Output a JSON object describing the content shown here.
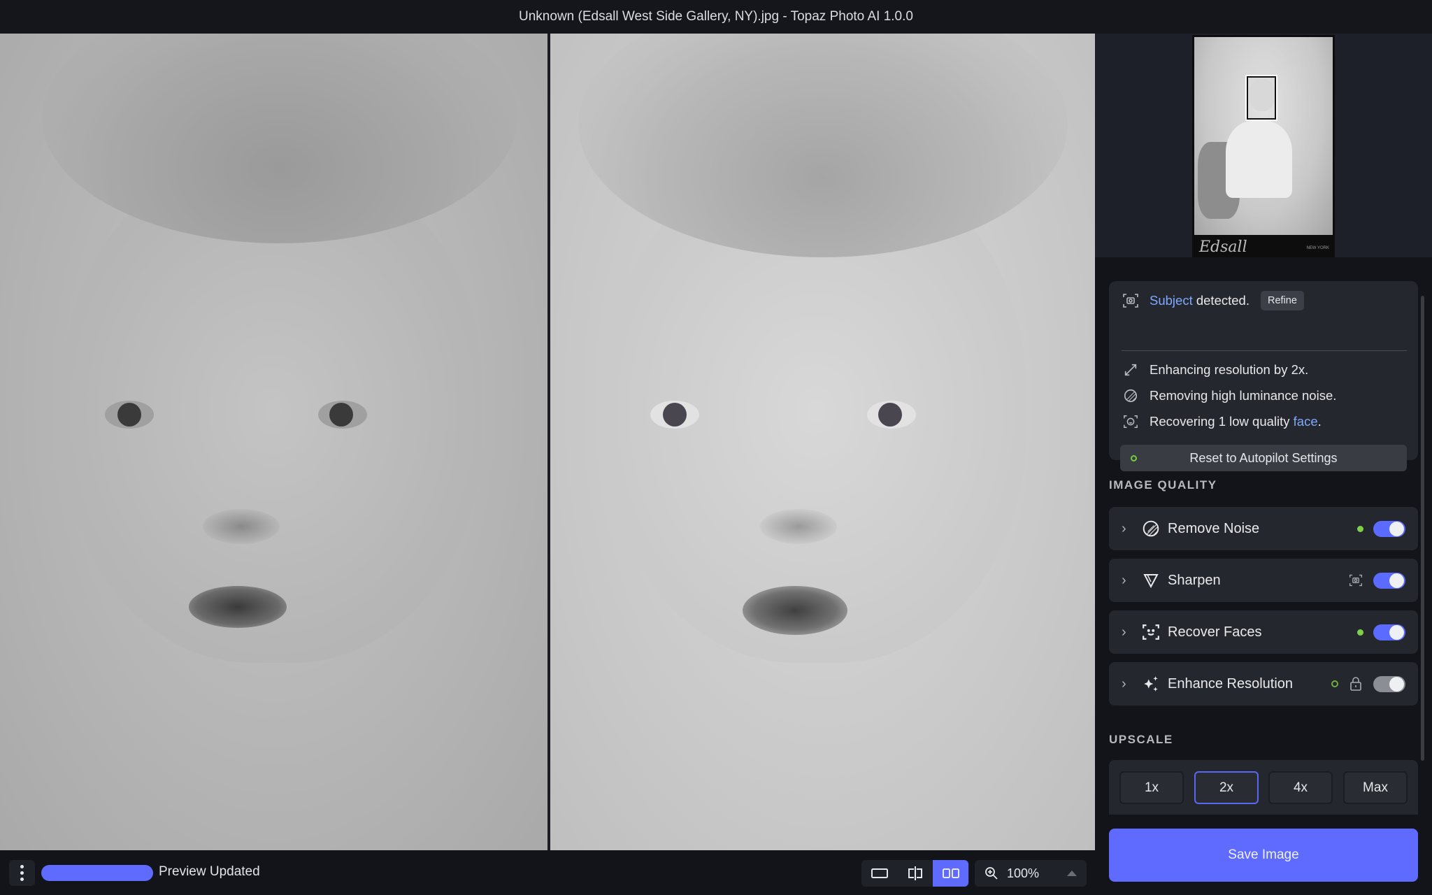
{
  "window": {
    "title": "Unknown (Edsall West Side Gallery, NY).jpg - Topaz Photo AI 1.0.0"
  },
  "viewer": {
    "left_pane": "original-image",
    "right_pane": "enhanced-preview"
  },
  "navigator": {
    "thumbnail_caption": "Edsall",
    "thumbnail_city": "NEW YORK"
  },
  "autopilot": {
    "subject_link": "Subject",
    "subject_text": " detected.",
    "refine_label": "Refine",
    "items": [
      {
        "icon": "resize-arrows-icon",
        "text": "Enhancing resolution by 2x."
      },
      {
        "icon": "noise-icon",
        "text": "Removing high luminance noise."
      },
      {
        "icon": "face-scan-icon",
        "text_before": "Recovering 1 low quality ",
        "link": "face",
        "text_after": "."
      }
    ],
    "reset_label": "Reset to Autopilot Settings"
  },
  "image_quality": {
    "title": "IMAGE QUALITY",
    "features": [
      {
        "label": "Remove Noise",
        "icon": "noise-icon",
        "indicator": "dot",
        "enabled": true
      },
      {
        "label": "Sharpen",
        "icon": "sharpen-icon",
        "indicator": "subject-icon",
        "enabled": true
      },
      {
        "label": "Recover Faces",
        "icon": "face-icon",
        "indicator": "dot",
        "enabled": true
      },
      {
        "label": "Enhance Resolution",
        "icon": "sparkle-icon",
        "indicator": "hollow-dot-lock",
        "enabled": true
      }
    ]
  },
  "upscale": {
    "title": "UPSCALE",
    "options": [
      "1x",
      "2x",
      "4x",
      "Max"
    ],
    "selected": "2x"
  },
  "save_label": "Save Image",
  "bottom": {
    "progress": 1.0,
    "status": "Preview Updated",
    "zoom": "100%",
    "view_modes": [
      "single",
      "split",
      "side-by-side"
    ],
    "active_view": "side-by-side"
  },
  "colors": {
    "accent": "#5f6aff",
    "indicator_green": "#7ed04a",
    "link": "#7fa8ff"
  }
}
